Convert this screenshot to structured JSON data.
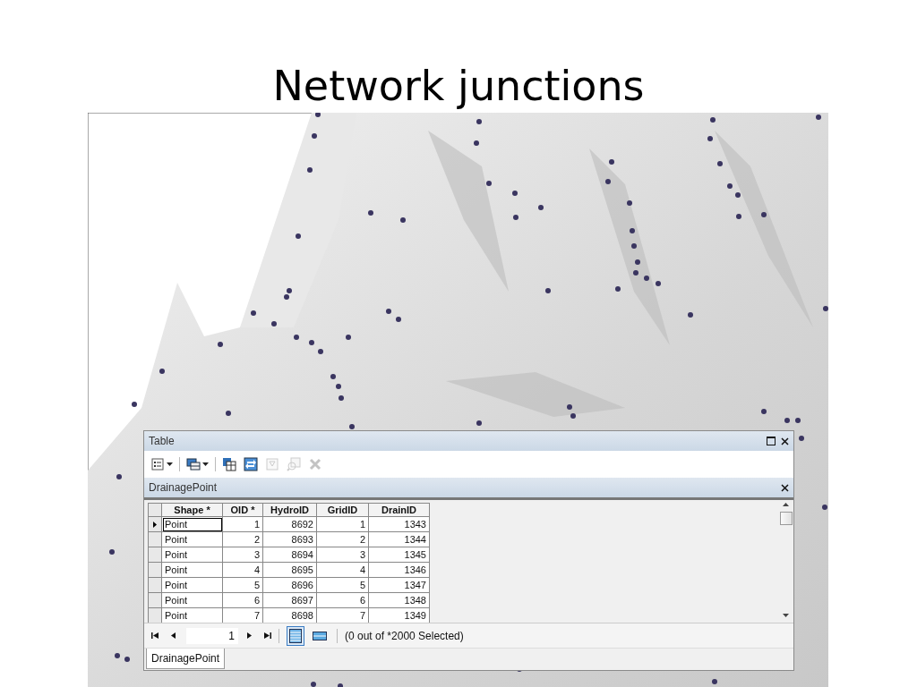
{
  "slide": {
    "title": "Network junctions"
  },
  "table_window": {
    "title": "Table",
    "toolbar": [
      {
        "kind": "options-menu",
        "disabled": false
      },
      {
        "kind": "related-menu",
        "disabled": false
      },
      {
        "kind": "select-by-attributes",
        "disabled": false
      },
      {
        "kind": "switch-selection",
        "disabled": false
      },
      {
        "kind": "clear-selection",
        "disabled": true
      },
      {
        "kind": "zoom-selected",
        "disabled": true
      },
      {
        "kind": "delete-selected",
        "disabled": true
      }
    ],
    "layer_title": "DrainagePoint",
    "columns": [
      "Shape *",
      "OID *",
      "HydroID",
      "GridID",
      "DrainID"
    ],
    "rows": [
      {
        "current": true,
        "cells": [
          "Point",
          "1",
          "8692",
          "1",
          "1343"
        ]
      },
      {
        "current": false,
        "cells": [
          "Point",
          "2",
          "8693",
          "2",
          "1344"
        ]
      },
      {
        "current": false,
        "cells": [
          "Point",
          "3",
          "8694",
          "3",
          "1345"
        ]
      },
      {
        "current": false,
        "cells": [
          "Point",
          "4",
          "8695",
          "4",
          "1346"
        ]
      },
      {
        "current": false,
        "cells": [
          "Point",
          "5",
          "8696",
          "5",
          "1347"
        ]
      },
      {
        "current": false,
        "cells": [
          "Point",
          "6",
          "8697",
          "6",
          "1348"
        ]
      },
      {
        "current": false,
        "cells": [
          "Point",
          "7",
          "8698",
          "7",
          "1349"
        ]
      }
    ],
    "record": "1",
    "views": [
      {
        "kind": "all-records",
        "selected": true
      },
      {
        "kind": "selected-records",
        "selected": false
      }
    ],
    "status": "(0 out of *2000 Selected)",
    "tabs": [
      {
        "label": "DrainagePoint",
        "selected": true
      }
    ]
  }
}
